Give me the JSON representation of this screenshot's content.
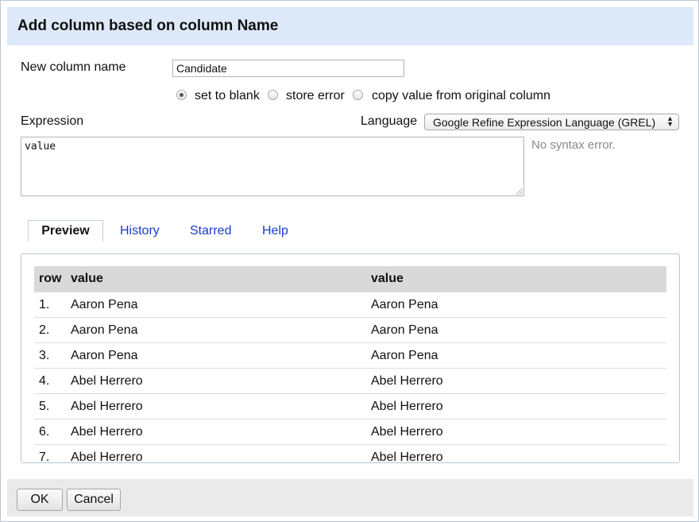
{
  "dialog": {
    "title": "Add column based on column Name"
  },
  "form": {
    "new_column_label": "New column name",
    "new_column_value": "Candidate",
    "on_error_options": [
      {
        "label": "set to blank",
        "checked": true
      },
      {
        "label": "store error",
        "checked": false
      },
      {
        "label": "copy value from original column",
        "checked": false
      }
    ],
    "expression_label": "Expression",
    "language_label": "Language",
    "language_selected": "Google Refine Expression Language (GREL)",
    "expression_value": "value",
    "syntax_status": "No syntax error."
  },
  "tabs": [
    {
      "label": "Preview",
      "active": true
    },
    {
      "label": "History",
      "active": false
    },
    {
      "label": "Starred",
      "active": false
    },
    {
      "label": "Help",
      "active": false
    }
  ],
  "preview": {
    "headers": [
      "row",
      "value",
      "value"
    ],
    "rows": [
      {
        "row": "1.",
        "value": "Aaron Pena",
        "result": "Aaron Pena"
      },
      {
        "row": "2.",
        "value": "Aaron Pena",
        "result": "Aaron Pena"
      },
      {
        "row": "3.",
        "value": "Aaron Pena",
        "result": "Aaron Pena"
      },
      {
        "row": "4.",
        "value": "Abel Herrero",
        "result": "Abel Herrero"
      },
      {
        "row": "5.",
        "value": "Abel Herrero",
        "result": "Abel Herrero"
      },
      {
        "row": "6.",
        "value": "Abel Herrero",
        "result": "Abel Herrero"
      },
      {
        "row": "7.",
        "value": "Abel Herrero",
        "result": "Abel Herrero"
      }
    ]
  },
  "footer": {
    "ok_label": "OK",
    "cancel_label": "Cancel"
  },
  "colors": {
    "title_bg": "#dde9f8",
    "link": "#1a3cc9",
    "table_header_bg": "#d9d9d9"
  }
}
